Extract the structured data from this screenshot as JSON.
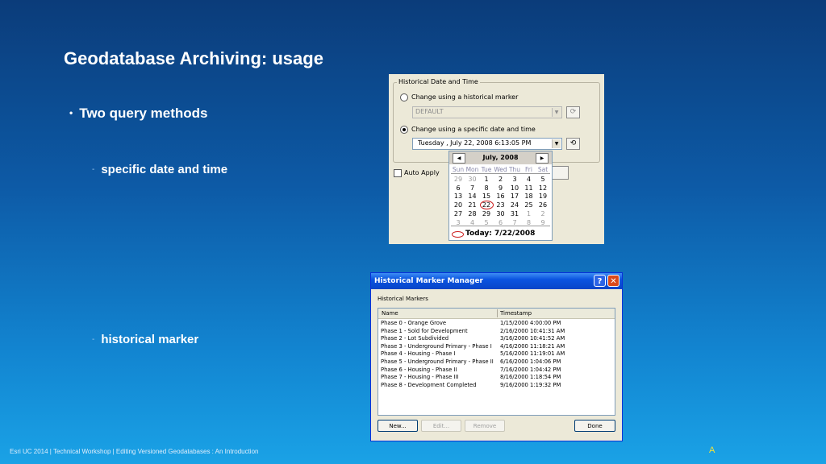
{
  "slide": {
    "title": "Geodatabase Archiving: usage",
    "bullet": "Two query methods",
    "sub1": "specific date and time",
    "sub2": "historical marker",
    "footer_left": "Esri UC 2014 | Technical Workshop |  Editing Versioned Geodatabases : An Introduction",
    "footer_right": "A"
  },
  "date_panel": {
    "group_title": "Historical Date and Time",
    "radio_marker_label": "Change using a historical marker",
    "marker_value": "DEFAULT",
    "radio_date_label": "Change using a specific date and time",
    "date_value": "Tuesday  ,    July     22, 2008   6:13:05 PM",
    "auto_apply_label": "Auto Apply",
    "calendar": {
      "month_title": "July, 2008",
      "weekdays": [
        "Sun",
        "Mon",
        "Tue",
        "Wed",
        "Thu",
        "Fri",
        "Sat"
      ],
      "weeks": [
        [
          "29",
          "30",
          "1",
          "2",
          "3",
          "4",
          "5"
        ],
        [
          "6",
          "7",
          "8",
          "9",
          "10",
          "11",
          "12"
        ],
        [
          "13",
          "14",
          "15",
          "16",
          "17",
          "18",
          "19"
        ],
        [
          "20",
          "21",
          "22",
          "23",
          "24",
          "25",
          "26"
        ],
        [
          "27",
          "28",
          "29",
          "30",
          "31",
          "1",
          "2"
        ],
        [
          "3",
          "4",
          "5",
          "6",
          "7",
          "8",
          "9"
        ]
      ],
      "selected_day": "22",
      "today_label": "Today: 7/22/2008"
    }
  },
  "marker_manager": {
    "window_title": "Historical Marker Manager",
    "section_label": "Historical Markers",
    "columns": [
      "Name",
      "Timestamp"
    ],
    "rows": [
      {
        "name": "Phase 0 - Orange Grove",
        "timestamp": "1/15/2000 4:00:00 PM"
      },
      {
        "name": "Phase 1 - Sold for Development",
        "timestamp": "2/16/2000 10:41:31 AM"
      },
      {
        "name": "Phase 2 - Lot Subdivided",
        "timestamp": "3/16/2000 10:41:52 AM"
      },
      {
        "name": "Phase 3 - Underground Primary - Phase I",
        "timestamp": "4/16/2000 11:18:21 AM"
      },
      {
        "name": "Phase 4 - Housing - Phase I",
        "timestamp": "5/16/2000 11:19:01 AM"
      },
      {
        "name": "Phase 5 - Underground Primary - Phase II",
        "timestamp": "6/16/2000 1:04:06 PM"
      },
      {
        "name": "Phase 6 - Housing - Phase II",
        "timestamp": "7/16/2000 1:04:42 PM"
      },
      {
        "name": "Phase 7 - Housing - Phase III",
        "timestamp": "8/16/2000 1:18:54 PM"
      },
      {
        "name": "Phase 8 - Development Completed",
        "timestamp": "9/16/2000 1:19:32 PM"
      }
    ],
    "buttons": {
      "new": "New...",
      "edit": "Edit...",
      "remove": "Remove",
      "done": "Done"
    },
    "help_glyph": "?",
    "close_glyph": "✕"
  },
  "colors": {
    "accent_red": "#cc1b1b",
    "footer_mark": "#f2e23a",
    "titlebar_blue": "#0a54e0"
  }
}
